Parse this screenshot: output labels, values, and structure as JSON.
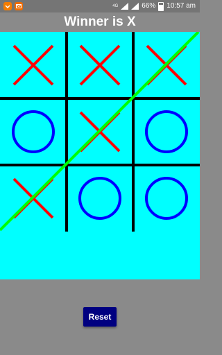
{
  "status_bar": {
    "signal": "4G",
    "battery_percent": "66%",
    "time": "10:57 am"
  },
  "title": "Winner is X",
  "board": {
    "cells": [
      [
        "X",
        "X",
        "X"
      ],
      [
        "O",
        "X",
        "O"
      ],
      [
        "X",
        "O",
        "O"
      ]
    ],
    "winning_line": "anti-diagonal",
    "colors": {
      "background": "#00ffff",
      "grid": "#000000",
      "x_mark": "#ff0000",
      "o_mark": "#0000ff",
      "win_line": "#00ff00"
    }
  },
  "reset_label": "Reset"
}
